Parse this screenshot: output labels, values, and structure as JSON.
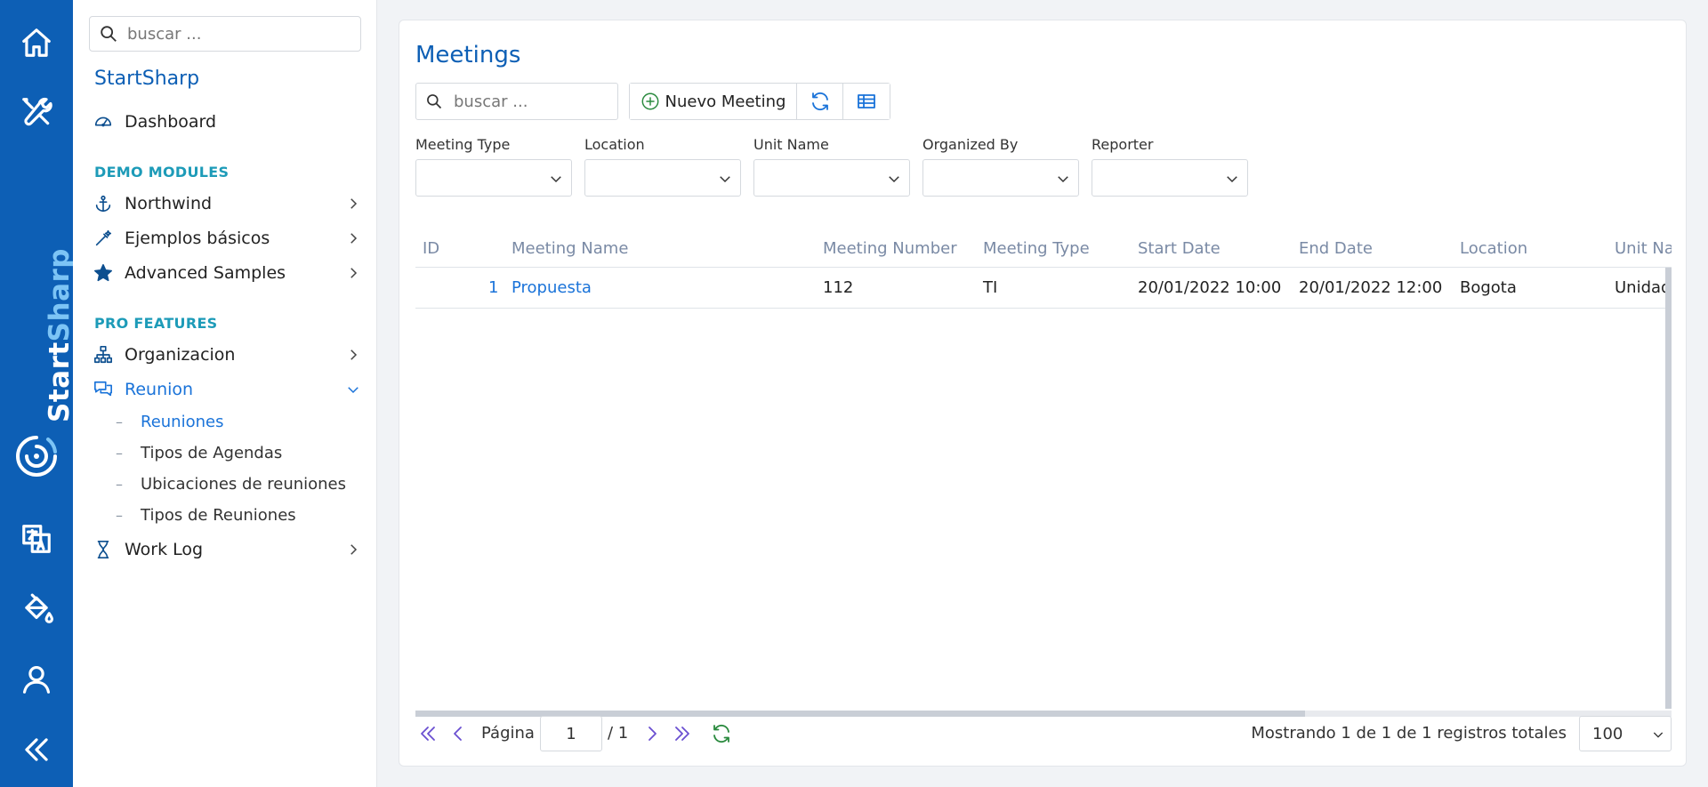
{
  "rail": {
    "brand_word1": "Start",
    "brand_word2": "Sharp",
    "brand_color": "#0d5fb5",
    "icons": [
      "home-icon",
      "tools-icon",
      "translate-icon",
      "paint-bucket-icon",
      "user-icon",
      "collapse-icon"
    ]
  },
  "sidebar": {
    "search_placeholder": "buscar ...",
    "app_title": "StartSharp",
    "dashboard": "Dashboard",
    "section_demo": "DEMO MODULES",
    "northwind": "Northwind",
    "basic_samples": "Ejemplos básicos",
    "advanced_samples": "Advanced Samples",
    "section_pro": "PRO FEATURES",
    "organization": "Organizacion",
    "meeting": "Reunion",
    "meeting_sub": [
      "Reuniones",
      "Tipos de Agendas",
      "Ubicaciones de reuniones",
      "Tipos de Reuniones"
    ],
    "work_log": "Work Log",
    "accent_color": "#1a73d9",
    "section_color": "#1d9bb8"
  },
  "main": {
    "title": "Meetings",
    "search_placeholder": "buscar ...",
    "new_button": "Nuevo Meeting",
    "filters": {
      "meeting_type": "Meeting Type",
      "location": "Location",
      "unit_name": "Unit Name",
      "organized_by": "Organized By",
      "reporter": "Reporter"
    },
    "columns": {
      "id": "ID",
      "meeting_name": "Meeting Name",
      "meeting_number": "Meeting Number",
      "meeting_type": "Meeting Type",
      "start_date": "Start Date",
      "end_date": "End Date",
      "location": "Location",
      "unit_name": "Unit Name"
    },
    "rows": [
      {
        "id": "1",
        "meeting_name": "Propuesta",
        "meeting_number": "112",
        "meeting_type": "TI",
        "start_date": "20/01/2022 10:00",
        "end_date": "20/01/2022 12:00",
        "location": "Bogota",
        "unit_name": "Unidad"
      }
    ],
    "pager": {
      "page_label": "Página",
      "page_value": "1",
      "page_total": "/ 1",
      "status": "Mostrando 1 de 1 de 1 registros totales",
      "page_size": "100"
    }
  }
}
